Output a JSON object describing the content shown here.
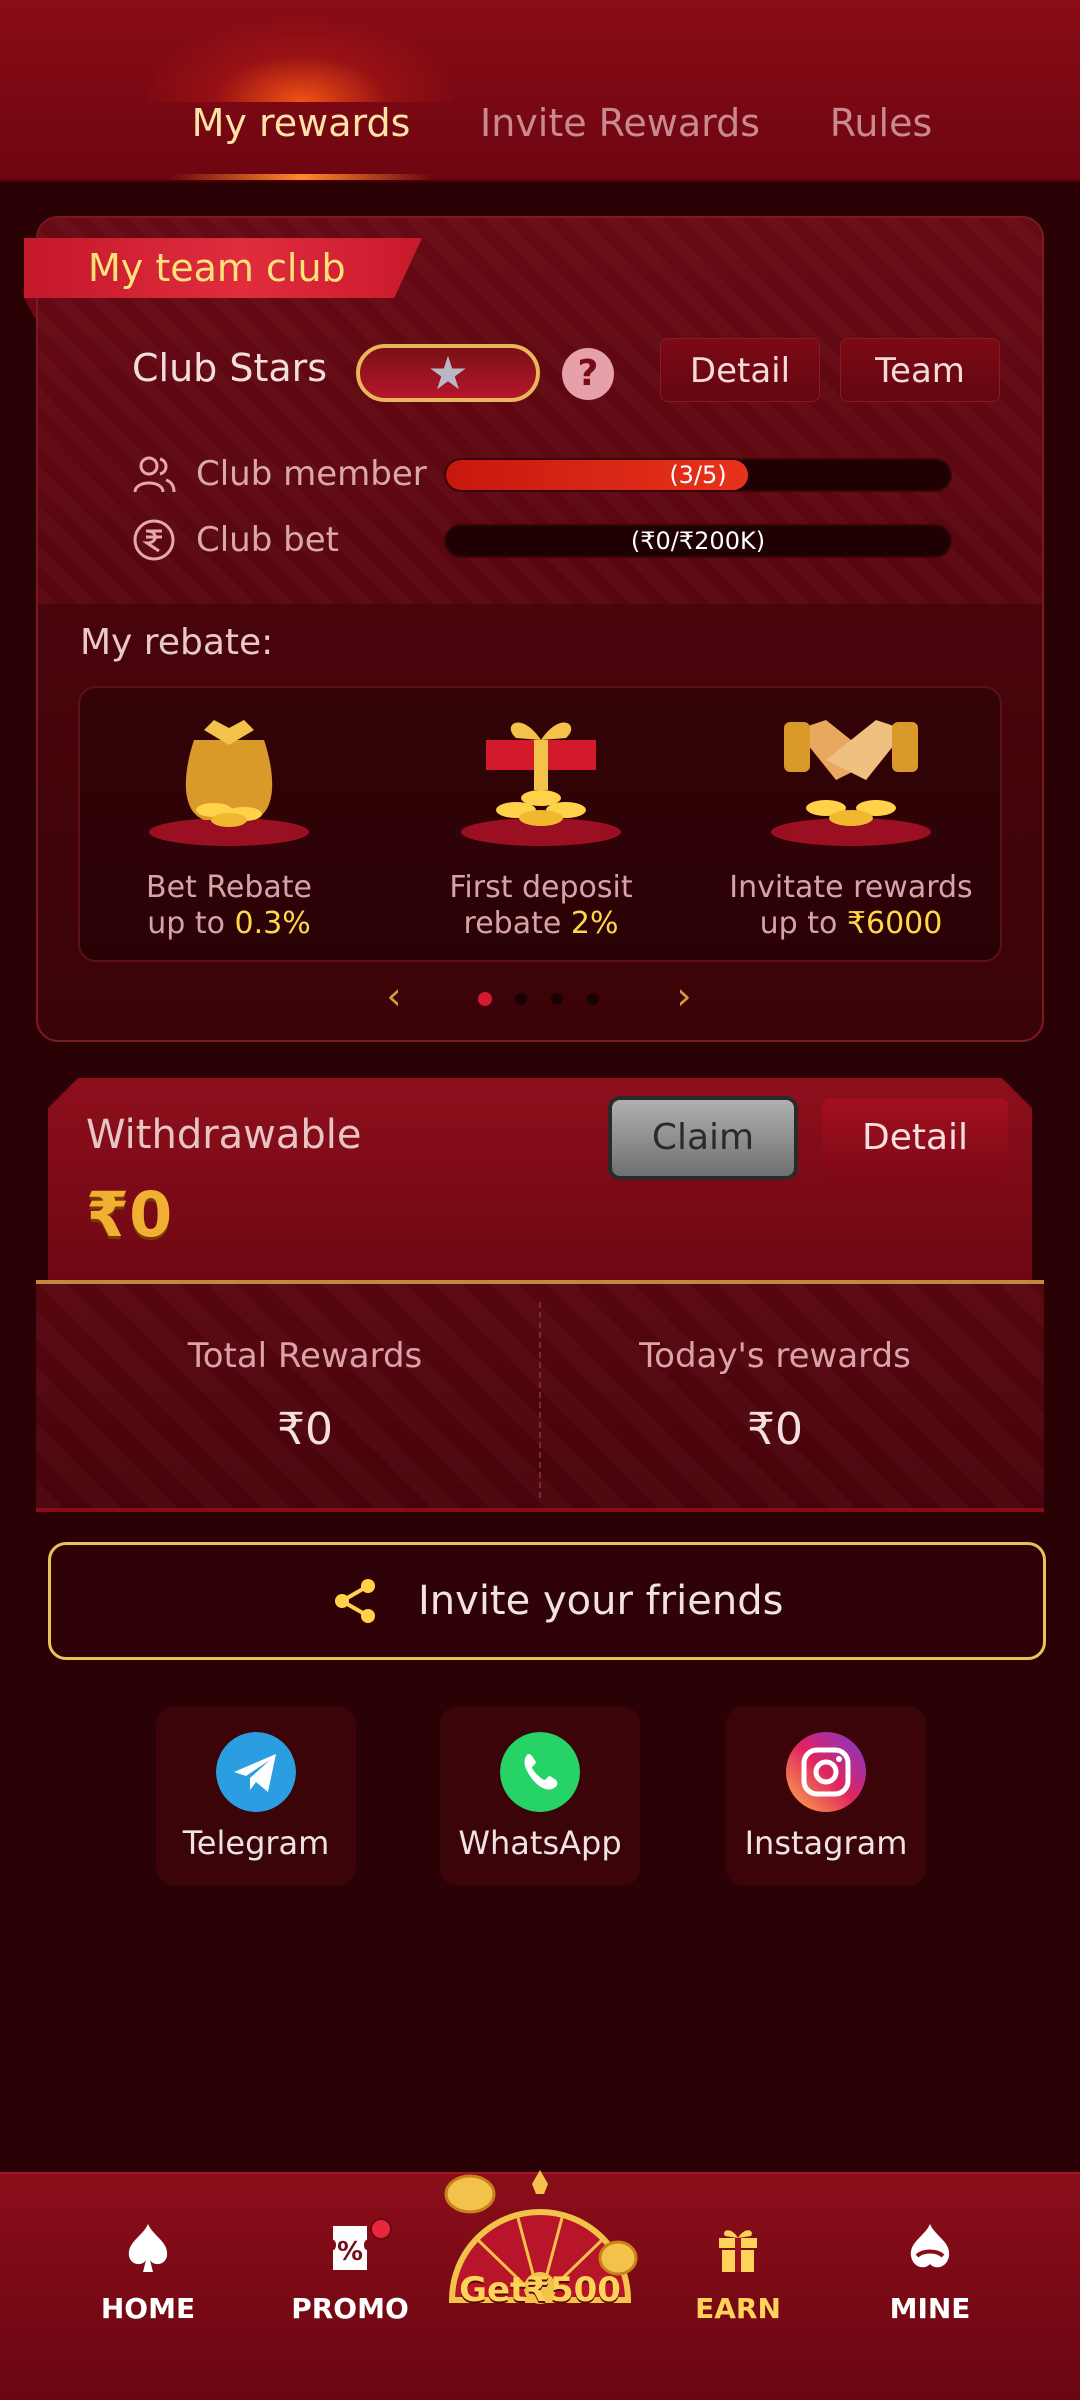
{
  "tabs": [
    {
      "label": "My rewards",
      "active": true
    },
    {
      "label": "Invite Rewards",
      "active": false
    },
    {
      "label": "Rules",
      "active": false
    }
  ],
  "club": {
    "title": "My team club",
    "stars_label": "Club Stars",
    "detail_label": "Detail",
    "team_label": "Team",
    "member_label": "Club member",
    "member_progress": "(3/5)",
    "member_fraction": 0.6,
    "bet_label": "Club bet",
    "bet_progress": "(₹0/₹200K)",
    "bet_fraction": 0
  },
  "rebate": {
    "title": "My rebate:",
    "items": [
      {
        "line1": "Bet Rebate",
        "line2_prefix": "up to ",
        "highlight": "0.3%"
      },
      {
        "line1": "First deposit",
        "line2_prefix": "rebate ",
        "highlight": "2%"
      },
      {
        "line1": "Invitate rewards",
        "line2_prefix": "up to ",
        "highlight": "₹6000"
      }
    ],
    "pager": {
      "total": 4,
      "active": 1
    }
  },
  "withdraw": {
    "label": "Withdrawable",
    "amount": "₹0",
    "claim_label": "Claim",
    "detail_label": "Detail"
  },
  "rewards": {
    "total_label": "Total Rewards",
    "total_value": "₹0",
    "today_label": "Today's rewards",
    "today_value": "₹0"
  },
  "invite": {
    "label": "Invite your friends",
    "social": [
      {
        "label": "Telegram",
        "icon": "telegram-icon",
        "color": "#2a9ee0"
      },
      {
        "label": "WhatsApp",
        "icon": "whatsapp-icon",
        "color": "#25d366"
      },
      {
        "label": "Instagram",
        "icon": "instagram-icon",
        "color": "#d6249f"
      }
    ]
  },
  "nav": {
    "home": "HOME",
    "promo": "PROMO",
    "center": "Get₹500",
    "earn": "EARN",
    "mine": "MINE",
    "active": "EARN"
  },
  "colors": {
    "accent_gold": "#ffd25a",
    "background": "#2a0205",
    "header": "#8a0d17"
  }
}
